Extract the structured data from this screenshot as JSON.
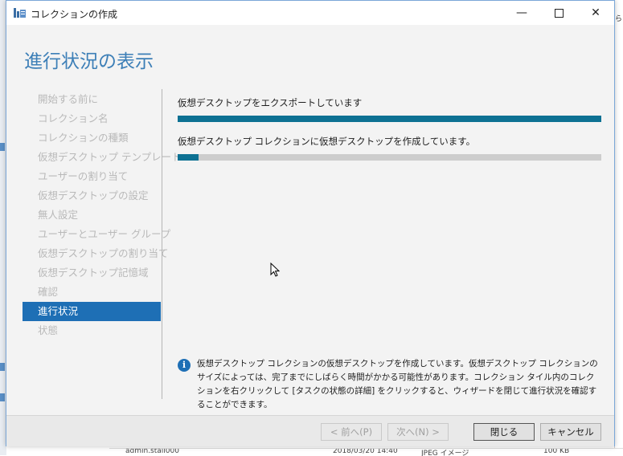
{
  "window": {
    "title": "コレクションの作成",
    "page_title": "進行状況の表示"
  },
  "nav": {
    "items": [
      {
        "label": "開始する前に",
        "active": false
      },
      {
        "label": "コレクション名",
        "active": false
      },
      {
        "label": "コレクションの種類",
        "active": false
      },
      {
        "label": "仮想デスクトップ テンプレート",
        "active": false
      },
      {
        "label": "ユーザーの割り当て",
        "active": false
      },
      {
        "label": "仮想デスクトップの設定",
        "active": false
      },
      {
        "label": "無人設定",
        "active": false
      },
      {
        "label": "ユーザーとユーザー グループ",
        "active": false
      },
      {
        "label": "仮想デスクトップの割り当て",
        "active": false
      },
      {
        "label": "仮想デスクトップ記憶域",
        "active": false
      },
      {
        "label": "確認",
        "active": false
      },
      {
        "label": "進行状況",
        "active": true
      },
      {
        "label": "状態",
        "active": false
      }
    ]
  },
  "tasks": [
    {
      "label": "仮想デスクトップをエクスポートしています",
      "progress": 1.0
    },
    {
      "label": "仮想デスクトップ コレクションに仮想デスクトップを作成しています。",
      "progress": 0.05
    }
  ],
  "info": {
    "text": "仮想デスクトップ コレクションの仮想デスクトップを作成しています。仮想デスクトップ コレクションのサイズによっては、完了までにしばらく時間がかかる可能性があります。コレクション タイル内のコレクションを右クリックして [タスクの状態の詳細] をクリックすると、ウィザードを閉じて進行状況を確認することができます。"
  },
  "buttons": {
    "prev": "< 前へ(P)",
    "next": "次へ(N) >",
    "close": "閉じる",
    "cancel": "キャンセル"
  },
  "background": {
    "right_hint": "ら",
    "bottom_name": "admin.stall000",
    "bottom_date": "2018/03/20 14:40",
    "bottom_type": "JPEG イメージ",
    "bottom_size": "100 KB"
  },
  "colors": {
    "accent": "#1e6fb5",
    "progress": "#0d7193",
    "title": "#3d7fb7"
  }
}
